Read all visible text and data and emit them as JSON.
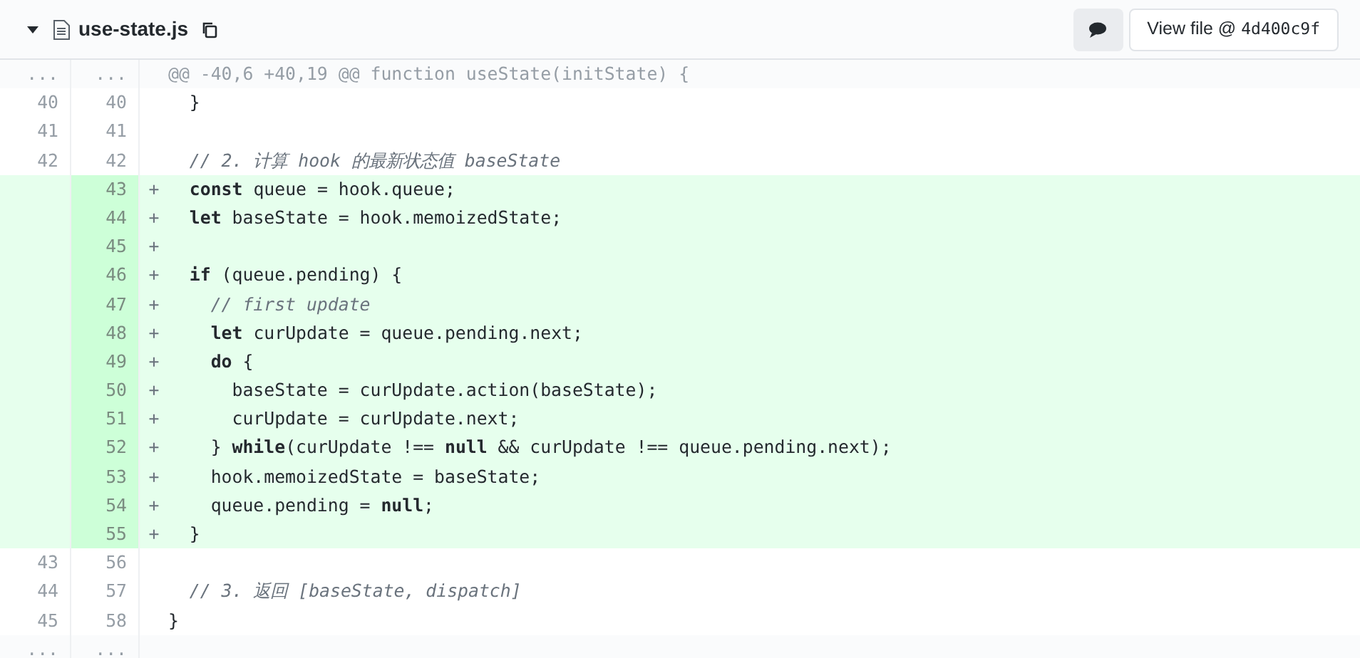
{
  "file": {
    "name": "use-state.js",
    "expanded": true
  },
  "actions": {
    "view_file_label": "View file @",
    "commit": "4d400c9f"
  },
  "rows": [
    {
      "kind": "hunk",
      "old": "...",
      "new": "...",
      "code": "@@ -40,6 +40,19 @@ function useState(initState) {"
    },
    {
      "kind": "context",
      "old": "40",
      "new": "40",
      "code": "  }"
    },
    {
      "kind": "context",
      "old": "41",
      "new": "41",
      "code": ""
    },
    {
      "kind": "context",
      "old": "42",
      "new": "42",
      "code": "  // 2. 计算 hook 的最新状态值 baseState",
      "comment": true
    },
    {
      "kind": "addition",
      "new": "43",
      "marker": "+",
      "code": "  **const** queue = hook.queue;"
    },
    {
      "kind": "addition",
      "new": "44",
      "marker": "+",
      "code": "  **let** baseState = hook.memoizedState;"
    },
    {
      "kind": "addition",
      "new": "45",
      "marker": "+",
      "code": ""
    },
    {
      "kind": "addition",
      "new": "46",
      "marker": "+",
      "code": "  **if** (queue.pending) {"
    },
    {
      "kind": "addition",
      "new": "47",
      "marker": "+",
      "code": "    // first update",
      "comment": true
    },
    {
      "kind": "addition",
      "new": "48",
      "marker": "+",
      "code": "    **let** curUpdate = queue.pending.next;"
    },
    {
      "kind": "addition",
      "new": "49",
      "marker": "+",
      "code": "    **do** {"
    },
    {
      "kind": "addition",
      "new": "50",
      "marker": "+",
      "code": "      baseState = curUpdate.action(baseState);"
    },
    {
      "kind": "addition",
      "new": "51",
      "marker": "+",
      "code": "      curUpdate = curUpdate.next;"
    },
    {
      "kind": "addition",
      "new": "52",
      "marker": "+",
      "code": "    } **while**(curUpdate !== **null** && curUpdate !== queue.pending.next);"
    },
    {
      "kind": "addition",
      "new": "53",
      "marker": "+",
      "code": "    hook.memoizedState = baseState;"
    },
    {
      "kind": "addition",
      "new": "54",
      "marker": "+",
      "code": "    queue.pending = **null**;"
    },
    {
      "kind": "addition",
      "new": "55",
      "marker": "+",
      "code": "  }"
    },
    {
      "kind": "context",
      "old": "43",
      "new": "56",
      "code": ""
    },
    {
      "kind": "context",
      "old": "44",
      "new": "57",
      "code": "  // 3. 返回 [baseState, dispatch]",
      "comment": true
    },
    {
      "kind": "context",
      "old": "45",
      "new": "58",
      "code": "}"
    },
    {
      "kind": "expander",
      "old": "...",
      "new": "..."
    }
  ]
}
